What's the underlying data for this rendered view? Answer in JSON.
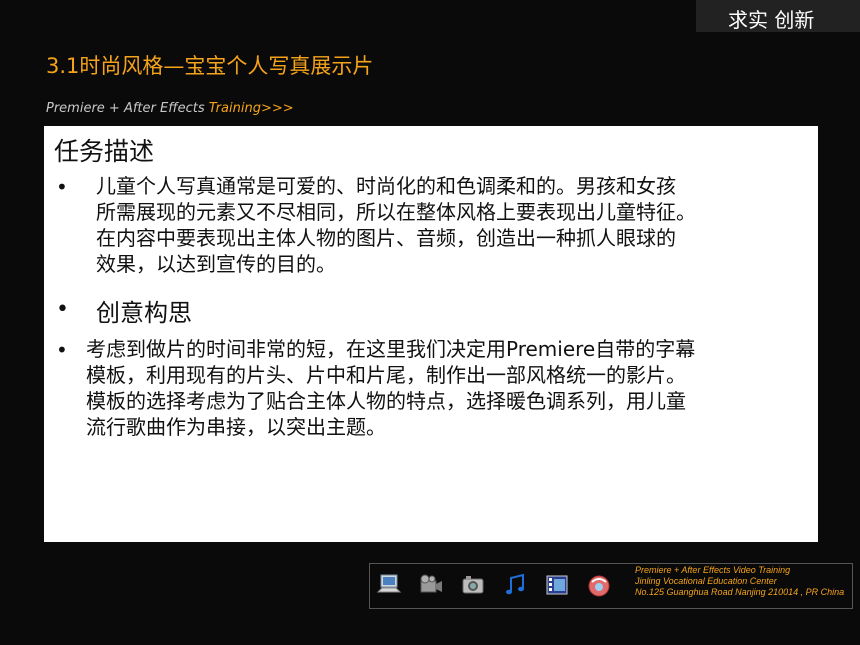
{
  "header": {
    "motto": "求实 创新",
    "title": "3.1时尚风格—宝宝个人写真展示片",
    "subtitle_prefix": "Premiere + After Effects ",
    "subtitle_accent": "Training>>>"
  },
  "content": {
    "heading": "任务描述",
    "bullet_symbol": "•",
    "paragraph1": [
      "儿童个人写真通常是可爱的、时尚化的和色调柔和的。男孩和女孩",
      "所需展现的元素又不尽相同，所以在整体风格上要表现出儿童特征。",
      "在内容中要表现出主体人物的图片、音频，创造出一种抓人眼球的",
      "效果，以达到宣传的目的。"
    ],
    "heading2": "创意构思",
    "paragraph2": [
      "考虑到做片的时间非常的短，在这里我们决定用Premiere自带的字幕",
      "模板，利用现有的片头、片中和片尾，制作出一部风格统一的影片。",
      "模板的选择考虑为了贴合主体人物的特点，选择暖色调系列，用儿童",
      "流行歌曲作为串接，以突出主题。"
    ]
  },
  "footer": {
    "icons": [
      "computer-icon",
      "video-camera-icon",
      "photo-camera-icon",
      "music-note-icon",
      "film-strip-icon",
      "gift-icon"
    ],
    "lines": [
      "Premiere + After Effects Video Training",
      "Jinling Vocational Education Center",
      "No.125 Guanghua Road Nanjing 210014 , PR China"
    ],
    "accent_color": "#f5a31a"
  }
}
